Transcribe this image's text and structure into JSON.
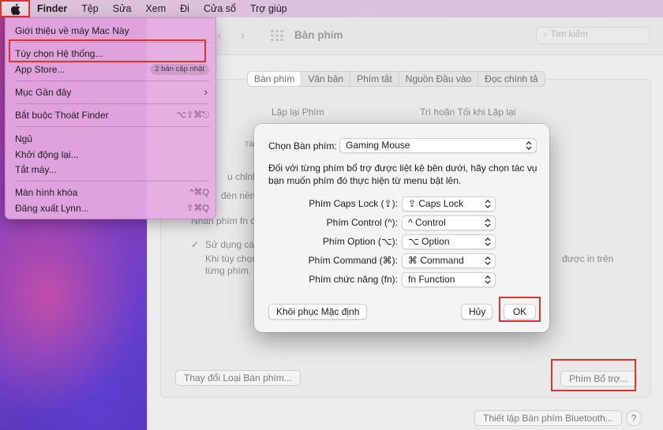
{
  "menubar": {
    "apple_icon": "apple-logo-icon",
    "items": [
      "Finder",
      "Tệp",
      "Sửa",
      "Xem",
      "Đi",
      "Cửa sổ",
      "Trợ giúp"
    ]
  },
  "apple_menu": {
    "about": "Giới thiệu về máy Mac Này",
    "system_prefs": "Tùy chọn Hệ thống...",
    "app_store": "App Store...",
    "app_store_badge": "2 bản cập nhật",
    "recent_items": "Mục Gần đây",
    "force_quit": "Bắt buộc Thoát Finder",
    "force_quit_shortcut": "⌥⇧⌘⎋",
    "sleep": "Ngủ",
    "restart": "Khởi động lại...",
    "shutdown": "Tắt máy...",
    "lock_screen": "Màn hình khóa",
    "lock_screen_shortcut": "^⌘Q",
    "logout": "Đăng xuất Lynn...",
    "logout_shortcut": "⇧⌘Q"
  },
  "window": {
    "title": "Bàn phím",
    "search_placeholder": "Tìm kiếm",
    "tabs": [
      "Bàn phím",
      "Văn bản",
      "Phím tắt",
      "Nguồn Đầu vào",
      "Đọc chính tả"
    ],
    "key_repeat_label": "Lặp lại Phím",
    "delay_label": "Trì hoãn Tối khi Lặp lại",
    "slider_start_label": "Tắt",
    "partial_1": "u chỉnh c",
    "partial_2": "đèn nền",
    "partial_3": "Nhấn phím fn đ",
    "partial_4": "Sử dụng các",
    "partial_5": "Khi tùy chọn",
    "partial_6": "từng phím.",
    "partial_7": "được in trên",
    "change_keyboard_type": "Thay đổi Loại Bàn phím...",
    "modifier_keys": "Phím Bổ trợ...",
    "bluetooth_setup": "Thiết lập Bàn phím Bluetooth...",
    "help": "?"
  },
  "sheet": {
    "select_keyboard_label": "Chọn Bàn phím:",
    "selected_keyboard": "Gaming Mouse",
    "description": "Đối với từng phím bổ trợ được liệt kê bên dưới, hãy chọn tác vụ bạn muốn phím đó thực hiện từ menu bật lên.",
    "modifiers": [
      {
        "label": "Phím Caps Lock (⇪):",
        "value": "⇪ Caps Lock"
      },
      {
        "label": "Phím Control (^):",
        "value": "^ Control"
      },
      {
        "label": "Phím Option (⌥):",
        "value": "⌥ Option"
      },
      {
        "label": "Phím Command (⌘):",
        "value": "⌘ Command"
      },
      {
        "label": "Phím chức năng (fn):",
        "value": "fn Function"
      }
    ],
    "restore_defaults": "Khôi phục Mặc định",
    "cancel": "Hủy",
    "ok": "OK"
  },
  "colors": {
    "highlight_box": "#e0332e",
    "menu_bg": "#e4aae1"
  }
}
